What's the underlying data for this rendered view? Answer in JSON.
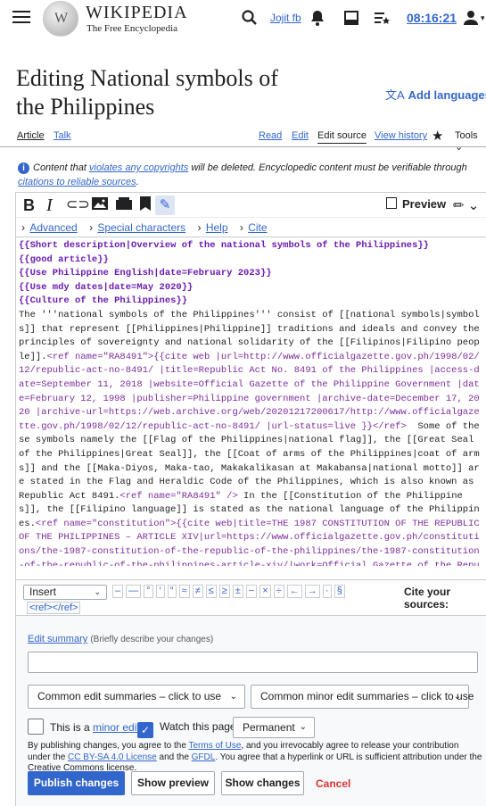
{
  "header": {
    "wordmark": "WIKIPEDIA",
    "tagline": "The Free Encyclopedia",
    "username": "Jojit fb",
    "clock": "08:16:21"
  },
  "page": {
    "title": "Editing National symbols of the Philippines",
    "add_languages": "Add languages"
  },
  "tabs": {
    "article": "Article",
    "talk": "Talk",
    "read": "Read",
    "edit": "Edit",
    "edit_source": "Edit source",
    "view_history": "View history",
    "tools": "Tools"
  },
  "notice": {
    "before": "Content that ",
    "link1": "violates any copyrights",
    "middle": " will be deleted. Encyclopedic content must be verifiable through ",
    "link2": "citations to reliable sources",
    "end": "."
  },
  "editor": {
    "preview_label": "Preview",
    "advanced": "Advanced",
    "special_characters": "Special characters",
    "help": "Help",
    "cite": "Cite"
  },
  "wikitext": {
    "l1": "{{Short description|Overview of the national symbols of the Philippines}}",
    "l2": "{{good article}}",
    "l3": "{{Use Philippine English|date=February 2023}}",
    "l4": "{{Use mdy dates|date=May 2020}}",
    "l5": "{{Culture of the Philippines}}",
    "body1": "The '''national symbols of the Philippines''' consist of [[national symbols|symbols]] that represent [[Philippines|Philippine]] traditions and ideals and convey the principles of sovereignty and national solidarity of the [[Filipinos|Filipino people]].",
    "ref1": "<ref name=\"RA8491\">{{cite web |url=http://www.officialgazette.gov.ph/1998/02/12/republic-act-no-8491/ |title=Republic Act No. 8491 of the Philippines |access-date=September 11, 2018 |website=Official Gazette of the Philippine Government |date=February 12, 1998 |publisher=Philippine government |archive-date=December 17, 2020 |archive-url=https://web.archive.org/web/20201217200617/http://www.officialgazette.gov.ph/1998/02/12/republic-act-no-8491/ |url-status=live }}</ref>",
    "body2": "  Some of these symbols namely the [[Flag of the Philippines|national flag]], the [[Great Seal of the Philippines|Great Seal]], the [[Coat of arms of the Philippines|coat of arms]] and the [[Maka-Diyos, Maka-tao, Makakalikasan at Makabansa|national motto]] are stated in the Flag and Heraldic Code of the Philippines, which is also known as Republic Act 8491.",
    "ref2": "<ref name=\"RA8491\" />",
    "body3": " In the [[Constitution of the Philippines]], the [[Filipino language]] is stated as the national language of the Philippines.",
    "ref3": "<ref name=\"constitution\">{{cite web|title=THE 1987 CONSTITUTION OF THE REPUBLIC OF THE PHILIPPINES – ARTICLE XIV|url=https://www.officialgazette.gov.ph/constitutions/the-1987-constitution-of-the-republic-of-the-philippines/the-1987-constitution-of-the-republic-of-the-philippines-article-xiv/|work=Official Gazette of the Republic of the"
  },
  "special": {
    "insert_label": "Insert",
    "chars": [
      "–",
      "—",
      "°",
      "′",
      "″",
      "≈",
      "≠",
      "≤",
      "≥",
      "±",
      "−",
      "×",
      "÷",
      "←",
      "→",
      "·",
      "§"
    ],
    "cite_sources": "Cite your sources:",
    "ref_tag": "<ref></ref>"
  },
  "form": {
    "edit_summary_link": "Edit summary",
    "edit_summary_hint": "(Briefly describe your changes)",
    "common_summaries": "Common edit summaries – click to use",
    "common_minor_summaries": "Common minor edit summaries – click to use",
    "minor_edit_prefix": "This is a ",
    "minor_edit_link": "minor edit",
    "watch_page": "Watch this page",
    "watch_period": "Permanent",
    "legal_1": "By publishing changes, you agree to the ",
    "terms": "Terms of Use",
    "legal_2": ", and you irrevocably agree to release your contribution under the ",
    "license": "CC BY-SA 4.0 License",
    "legal_3": " and the ",
    "gfdl": "GFDL",
    "legal_4": ". You agree that a hyperlink or URL is sufficient attribution under the Creative Commons license.",
    "publish": "Publish changes",
    "show_preview": "Show preview",
    "show_changes": "Show changes",
    "cancel": "Cancel"
  }
}
